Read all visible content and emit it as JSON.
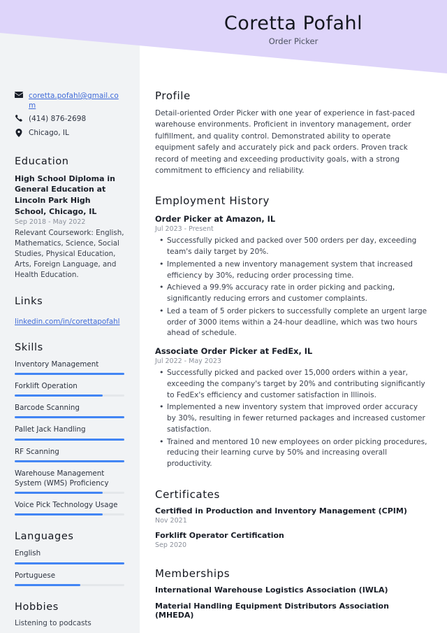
{
  "theme": {
    "banner_color": "#ded5fa",
    "sidebar_color": "#f1f3f5",
    "accent_color": "#4285f4",
    "link_color": "#3f6ad8"
  },
  "header": {
    "name": "Coretta Pofahl",
    "role": "Order Picker"
  },
  "sidebar": {
    "contact": [
      {
        "icon": "envelope-icon",
        "text": "coretta.pofahl@gmail.com",
        "is_link": true
      },
      {
        "icon": "phone-icon",
        "text": "(414) 876-2698",
        "is_link": false
      },
      {
        "icon": "location-pin-icon",
        "text": "Chicago, IL",
        "is_link": false
      }
    ],
    "education": {
      "heading": "Education",
      "title": "High School Diploma in General Education at Lincoln Park High School, Chicago, IL",
      "date": "Sep 2018 - May 2022",
      "description": "Relevant Coursework: English, Mathematics, Science, Social Studies, Physical Education, Arts, Foreign Language, and Health Education."
    },
    "links": {
      "heading": "Links",
      "items": [
        {
          "text": "linkedin.com/in/corettapofahl"
        }
      ]
    },
    "skills": {
      "heading": "Skills",
      "items": [
        {
          "label": "Inventory Management",
          "level": 100
        },
        {
          "label": "Forklift Operation",
          "level": 80
        },
        {
          "label": "Barcode Scanning",
          "level": 100
        },
        {
          "label": "Pallet Jack Handling",
          "level": 100
        },
        {
          "label": "RF Scanning",
          "level": 100
        },
        {
          "label": "Warehouse Management System (WMS) Proficiency",
          "level": 80
        },
        {
          "label": "Voice Pick Technology Usage",
          "level": 80
        }
      ]
    },
    "languages": {
      "heading": "Languages",
      "items": [
        {
          "label": "English",
          "level": 100
        },
        {
          "label": "Portuguese",
          "level": 60
        }
      ]
    },
    "hobbies": {
      "heading": "Hobbies",
      "items": [
        {
          "text": "Listening to podcasts"
        }
      ]
    }
  },
  "main": {
    "profile": {
      "heading": "Profile",
      "text": "Detail-oriented Order Picker with one year of experience in fast-paced warehouse environments. Proficient in inventory management, order fulfillment, and quality control. Demonstrated ability to operate equipment safely and accurately pick and pack orders. Proven track record of meeting and exceeding productivity goals, with a strong commitment to efficiency and reliability."
    },
    "employment": {
      "heading": "Employment History",
      "jobs": [
        {
          "title": "Order Picker at Amazon, IL",
          "date": "Jul 2023 - Present",
          "bullets": [
            "Successfully picked and packed over 500 orders per day, exceeding team's daily target by 20%.",
            "Implemented a new inventory management system that increased efficiency by 30%, reducing order processing time.",
            "Achieved a 99.9% accuracy rate in order picking and packing, significantly reducing errors and customer complaints.",
            "Led a team of 5 order pickers to successfully complete an urgent large order of 3000 items within a 24-hour deadline, which was two hours ahead of schedule."
          ]
        },
        {
          "title": "Associate Order Picker at FedEx, IL",
          "date": "Jul 2022 - May 2023",
          "bullets": [
            "Successfully picked and packed over 15,000 orders within a year, exceeding the company's target by 20% and contributing significantly to FedEx's efficiency and customer satisfaction in Illinois.",
            "Implemented a new inventory system that improved order accuracy by 30%, resulting in fewer returned packages and increased customer satisfaction.",
            "Trained and mentored 10 new employees on order picking procedures, reducing their learning curve by 50% and increasing overall productivity."
          ]
        }
      ]
    },
    "certificates": {
      "heading": "Certificates",
      "items": [
        {
          "title": "Certified in Production and Inventory Management (CPIM)",
          "date": "Nov 2021"
        },
        {
          "title": "Forklift Operator Certification",
          "date": "Sep 2020"
        }
      ]
    },
    "memberships": {
      "heading": "Memberships",
      "items": [
        {
          "title": "International Warehouse Logistics Association (IWLA)"
        },
        {
          "title": "Material Handling Equipment Distributors Association (MHEDA)"
        }
      ]
    }
  }
}
